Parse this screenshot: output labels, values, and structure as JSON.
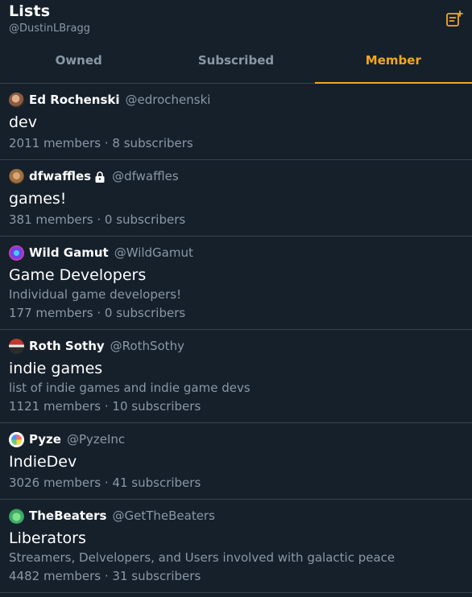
{
  "header": {
    "title": "Lists",
    "handle": "@DustinLBragg",
    "new_list_icon": "new-list-icon"
  },
  "tabs": [
    {
      "label": "Owned",
      "active": false
    },
    {
      "label": "Subscribed",
      "active": false
    },
    {
      "label": "Member",
      "active": true
    }
  ],
  "colors": {
    "background": "#15202b",
    "accent": "#f5a623",
    "muted": "#8b98a5",
    "divider": "#38444d"
  },
  "lists": [
    {
      "owner_name": "Ed Rochenski",
      "owner_handle": "@edrochenski",
      "locked": false,
      "name": "dev",
      "description": "",
      "stats": "2011 members · 8 subscribers",
      "avatar_color": "#8a5a44"
    },
    {
      "owner_name": "dfwaffles",
      "owner_handle": "@dfwaffles",
      "locked": true,
      "name": "games!",
      "description": "",
      "stats": "381 members · 0 subscribers",
      "avatar_color": "#a07040"
    },
    {
      "owner_name": "Wild Gamut",
      "owner_handle": "@WildGamut",
      "locked": false,
      "name": "Game Developers",
      "description": "Individual game developers!",
      "stats": "177 members · 0 subscribers",
      "avatar_color": "#7b3fe4"
    },
    {
      "owner_name": "Roth Sothy",
      "owner_handle": "@RothSothy",
      "locked": false,
      "name": "indie games",
      "description": "list of indie games and indie game devs",
      "stats": "1121 members · 10 subscribers",
      "avatar_color": "#c0392b"
    },
    {
      "owner_name": "Pyze",
      "owner_handle": "@PyzeInc",
      "locked": false,
      "name": "IndieDev",
      "description": "",
      "stats": "3026 members · 41 subscribers",
      "avatar_color": "#ffffff"
    },
    {
      "owner_name": "TheBeaters",
      "owner_handle": "@GetTheBeaters",
      "locked": false,
      "name": "Liberators",
      "description": "Streamers, Delvelopers, and Users involved with galactic peace",
      "stats": "4482 members · 31 subscribers",
      "avatar_color": "#3fa96b"
    }
  ]
}
